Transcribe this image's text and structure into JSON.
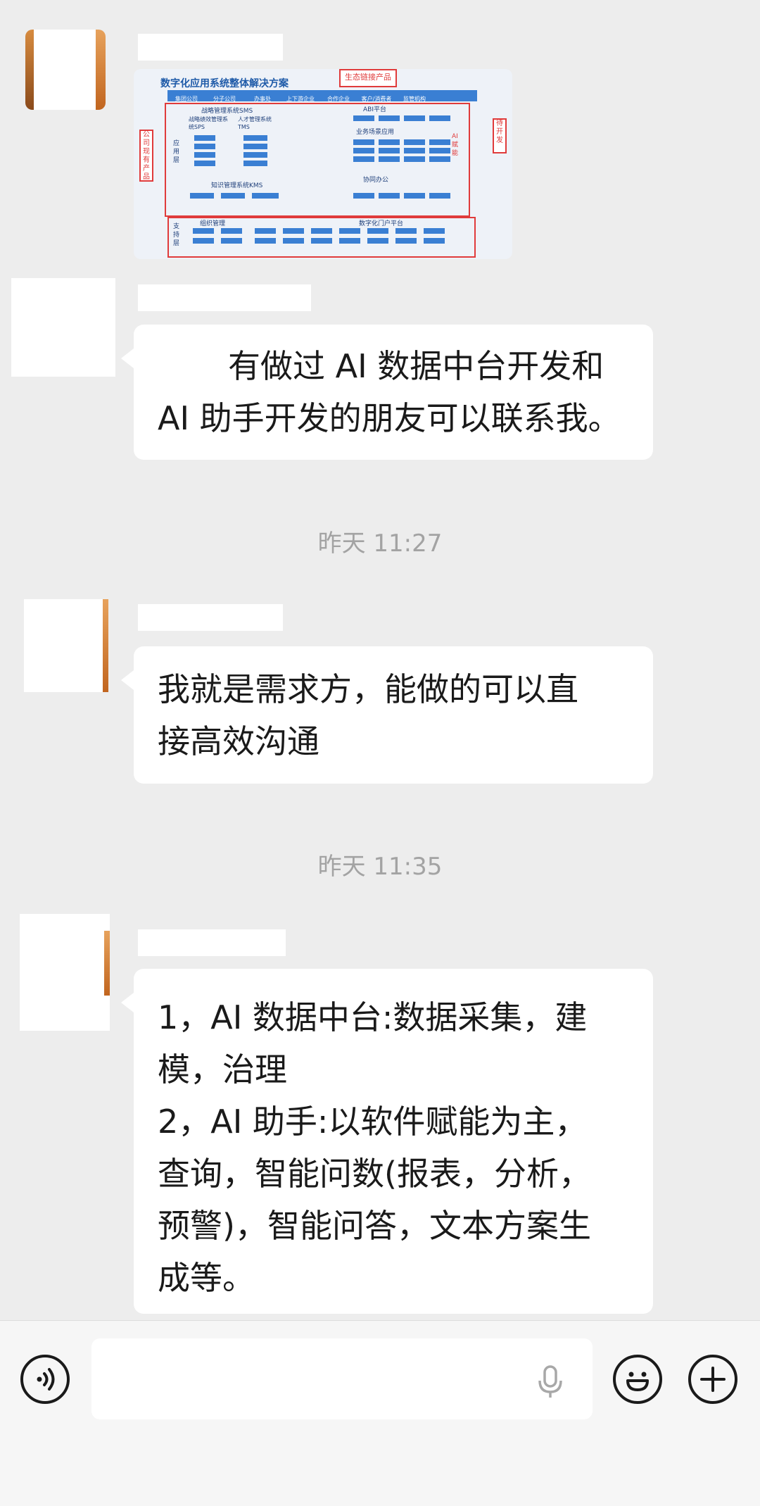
{
  "messages": [
    {
      "type": "image",
      "image": {
        "title": "数字化应用系统整体解决方案",
        "eco_label": "生态链接产品",
        "band_items": [
          "集团公司",
          "分子公司",
          "办事处",
          "上下游企业",
          "合作企业",
          "客户/消费者",
          "监管机构"
        ],
        "left_side": "公司现有产品",
        "right_side": "待开发",
        "app_layer": "应用层",
        "support_layer": "支持层",
        "ai_label": "AI赋能",
        "sms": "战略管理系统SMS",
        "sps": "战略绩效管理系统SPS",
        "tms": "人才管理系统TMS",
        "kms": "知识管理系统KMS",
        "abi": "ABI平台",
        "biz": "业务场景应用",
        "office": "协同办公",
        "org": "组织管理",
        "portal": "数字化门户平台"
      }
    },
    {
      "type": "text",
      "lines": [
        "有做过 AI 数据中台开发和",
        "AI 助手开发的朋友可以联系我。"
      ]
    },
    {
      "type": "time",
      "label": "昨天 11:27"
    },
    {
      "type": "text",
      "lines": [
        "我就是需求方，能做的可以直",
        "接高效沟通"
      ]
    },
    {
      "type": "time",
      "label": "昨天 11:35"
    },
    {
      "type": "text",
      "lines": [
        "1，AI 数据中台:数据采集，建",
        "模，治理",
        "2，AI 助手:以软件赋能为主，",
        "查询，智能问数(报表，分析，",
        "预警)，智能问答，文本方案生",
        "成等。"
      ]
    }
  ],
  "input_bar": {
    "voice_icon": "voice-icon",
    "mic_icon": "microphone-icon",
    "emoji_icon": "emoji-icon",
    "plus_icon": "plus-icon"
  }
}
